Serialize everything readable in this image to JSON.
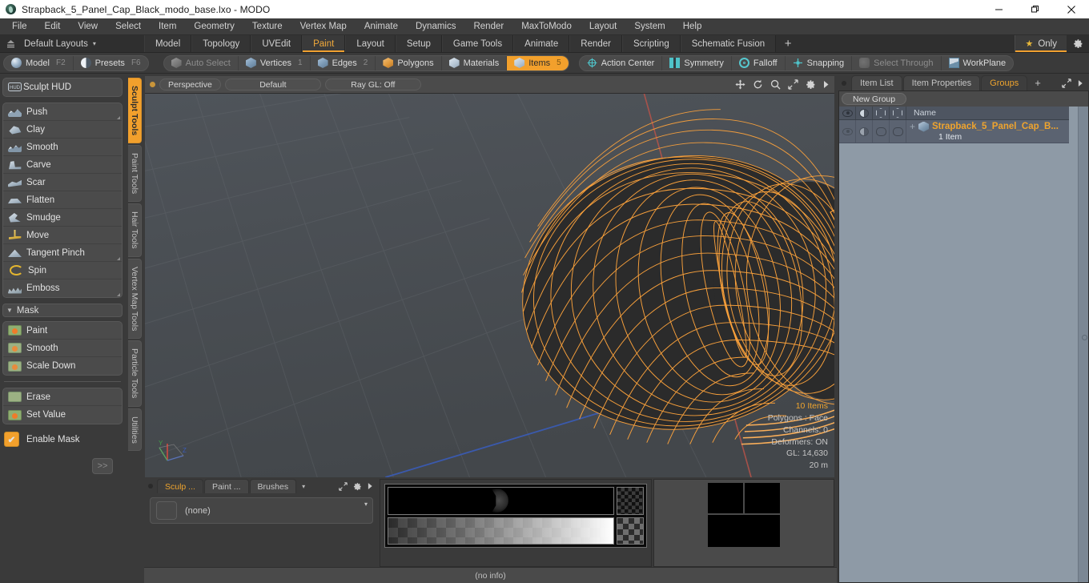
{
  "titlebar": {
    "title": "Strapback_5_Panel_Cap_Black_modo_base.lxo - MODO",
    "logo_icon": "modo-logo-icon",
    "minimize": "–",
    "maximize": "❐",
    "close": "✕"
  },
  "menubar": {
    "items": [
      "File",
      "Edit",
      "View",
      "Select",
      "Item",
      "Geometry",
      "Texture",
      "Vertex Map",
      "Animate",
      "Dynamics",
      "Render",
      "MaxToModo",
      "Layout",
      "System",
      "Help"
    ]
  },
  "layoutbar": {
    "home_icon": "home-up-icon",
    "default_layouts": "Default Layouts",
    "caret": "▾",
    "tabs": [
      {
        "label": "Model",
        "selected": false
      },
      {
        "label": "Topology",
        "selected": false
      },
      {
        "label": "UVEdit",
        "selected": false
      },
      {
        "label": "Paint",
        "selected": true
      },
      {
        "label": "Layout",
        "selected": false
      },
      {
        "label": "Setup",
        "selected": false
      },
      {
        "label": "Game Tools",
        "selected": false
      },
      {
        "label": "Animate",
        "selected": false
      },
      {
        "label": "Render",
        "selected": false
      },
      {
        "label": "Scripting",
        "selected": false
      },
      {
        "label": "Schematic Fusion",
        "selected": false
      }
    ],
    "add_tab": "+",
    "only_label": "Only",
    "star_icon": "star-icon",
    "gear_icon": "gear-icon"
  },
  "modebar": {
    "left_group": [
      {
        "label": "Model",
        "key": "F2",
        "icon": "sphere-icon",
        "state": "normal"
      },
      {
        "label": "Presets",
        "key": "F6",
        "icon": "preset-sphere-icon",
        "state": "normal"
      }
    ],
    "select_group": [
      {
        "label": "Auto Select",
        "key": "",
        "icon": "cube-gray-icon",
        "state": "dim"
      },
      {
        "label": "Vertices",
        "key": "1",
        "icon": "cube-blue-icon",
        "state": "normal"
      },
      {
        "label": "Edges",
        "key": "2",
        "icon": "cube-blue-icon",
        "state": "normal"
      },
      {
        "label": "Polygons",
        "key": "",
        "icon": "cube-orange-icon",
        "state": "normal"
      },
      {
        "label": "Materials",
        "key": "",
        "icon": "cube-white-icon",
        "state": "normal"
      },
      {
        "label": "Items",
        "key": "5",
        "icon": "cube-white-icon",
        "state": "active"
      }
    ],
    "right_group": [
      {
        "label": "Action Center",
        "icon": "crosshair-icon",
        "state": "normal"
      },
      {
        "label": "Symmetry",
        "icon": "symmetry-icon",
        "state": "normal"
      },
      {
        "label": "Falloff",
        "icon": "falloff-ring-icon",
        "state": "normal"
      },
      {
        "label": "Snapping",
        "icon": "snap-icon",
        "state": "normal"
      },
      {
        "label": "Select Through",
        "icon": "select-through-icon",
        "state": "dim"
      },
      {
        "label": "WorkPlane",
        "icon": "workplane-icon",
        "state": "normal"
      }
    ]
  },
  "left_panel": {
    "hud_button": {
      "label": "Sculpt HUD",
      "icon": "hud-icon"
    },
    "sculpt_tools": [
      {
        "label": "Push",
        "icon": "push-icon",
        "has_corner": true
      },
      {
        "label": "Clay",
        "icon": "clay-icon",
        "has_corner": false
      },
      {
        "label": "Smooth",
        "icon": "smooth-icon",
        "has_corner": false
      },
      {
        "label": "Carve",
        "icon": "carve-icon",
        "has_corner": false
      },
      {
        "label": "Scar",
        "icon": "scar-icon",
        "has_corner": false
      },
      {
        "label": "Flatten",
        "icon": "flatten-icon",
        "has_corner": false
      },
      {
        "label": "Smudge",
        "icon": "smudge-icon",
        "has_corner": false
      },
      {
        "label": "Move",
        "icon": "move-icon",
        "has_corner": false
      },
      {
        "label": "Tangent Pinch",
        "icon": "tangent-pinch-icon",
        "has_corner": true
      },
      {
        "label": "Spin",
        "icon": "spin-icon",
        "has_corner": false
      },
      {
        "label": "Emboss",
        "icon": "emboss-icon",
        "has_corner": true
      }
    ],
    "mask_section": {
      "title": "Mask",
      "triangle": "▼",
      "tools": [
        {
          "label": "Paint",
          "icon": "mask-paint-icon"
        },
        {
          "label": "Smooth",
          "icon": "mask-smooth-icon"
        },
        {
          "label": "Scale Down",
          "icon": "mask-scale-down-icon"
        }
      ],
      "tools2": [
        {
          "label": "Erase",
          "icon": "mask-erase-icon"
        },
        {
          "label": "Set Value",
          "icon": "mask-set-value-icon"
        }
      ],
      "enable_mask": {
        "label": "Enable Mask",
        "checked": true,
        "check_glyph": "✔"
      },
      "more_button": ">>"
    },
    "vertical_tabs": [
      {
        "label": "Sculpt Tools",
        "selected": true
      },
      {
        "label": "Paint Tools",
        "selected": false
      },
      {
        "label": "Hair Tools",
        "selected": false
      },
      {
        "label": "Vertex Map Tools",
        "selected": false
      },
      {
        "label": "Particle Tools",
        "selected": false
      },
      {
        "label": "Utilities",
        "selected": false
      }
    ]
  },
  "viewport": {
    "header": {
      "dot_icon": "viewport-dot-icon",
      "pills": [
        "Perspective",
        "Default",
        "Ray GL: Off"
      ],
      "tools": [
        "pan-icon",
        "rotate-icon",
        "zoom-icon",
        "fit-icon",
        "gear-icon",
        "more-arrow-icon"
      ]
    },
    "info": {
      "items_count": "10 Items",
      "polygons": "Polygons : Face",
      "channels": "Channels: 0",
      "deformers": "Deformers: ON",
      "gl": "GL: 14,630",
      "scale": "20 m"
    },
    "gizmo": {
      "x": "X",
      "y": "Y",
      "z": "Z"
    },
    "colors": {
      "background": "#4a4e52",
      "wireframe": "#ffa43c",
      "mesh_fill": "#2b2b2b",
      "axis_x": "#b9554d",
      "axis_z": "#3f5fb0"
    }
  },
  "bottom_panel": {
    "left": {
      "tabs": [
        {
          "label": "Sculp ...",
          "selected": true
        },
        {
          "label": "Paint ...",
          "selected": false
        },
        {
          "label": "Brushes",
          "selected": false
        }
      ],
      "caret": "▾",
      "tools": [
        "expand-icon",
        "gear-icon",
        "more-arrow-icon"
      ],
      "brush_value": "(none)",
      "dropdown_caret": "▾"
    },
    "status": "(no info)"
  },
  "right_panel": {
    "dot_icon": "panel-dot-icon",
    "tabs": [
      {
        "label": "Item List",
        "selected": false
      },
      {
        "label": "Item Properties",
        "selected": false
      },
      {
        "label": "Groups",
        "selected": true
      }
    ],
    "add_tab": "+",
    "tools": [
      "expand-icon",
      "more-arrow-icon"
    ],
    "new_group_button": "New Group",
    "columns": {
      "visibility_icon": "eye-icon",
      "shading_icon": "shading-icon",
      "wire_icon": "wireframe-cube-icon",
      "render_icon": "render-cube-icon",
      "name": "Name"
    },
    "rows": [
      {
        "expand": "+",
        "group_icon": "group-cube-icon",
        "name": "Strapback_5_Panel_Cap_B...",
        "subtitle": "1 Item",
        "visible": true
      }
    ]
  }
}
